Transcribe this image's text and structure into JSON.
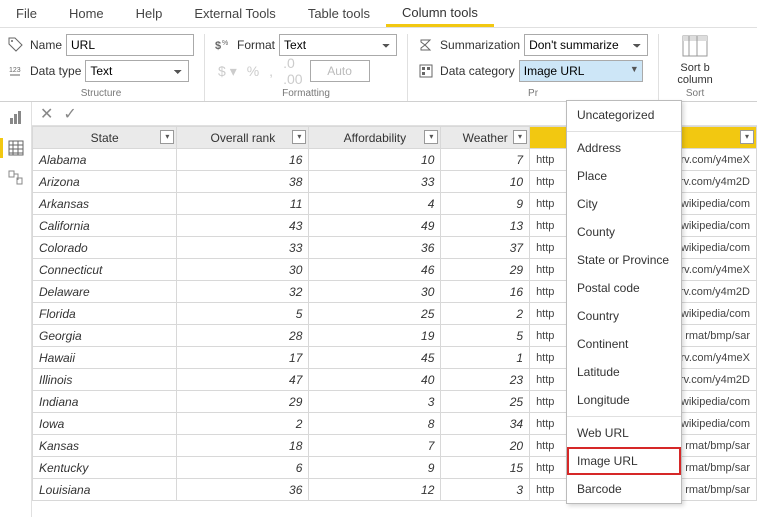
{
  "menu": {
    "items": [
      "File",
      "Home",
      "Help",
      "External Tools",
      "Table tools",
      "Column tools"
    ],
    "active": 5
  },
  "ribbon": {
    "name_label": "Name",
    "name_value": "URL",
    "datatype_label": "Data type",
    "datatype_value": "Text",
    "format_label": "Format",
    "format_value": "Text",
    "auto_label": "Auto",
    "summ_label": "Summarization",
    "summ_value": "Don't summarize",
    "datacat_label": "Data category",
    "datacat_value": "Image URL",
    "group_structure": "Structure",
    "group_formatting": "Formatting",
    "group_properties": "Pr",
    "group_sort": "Sort",
    "sort_label": "Sort b",
    "sort_label2": "column"
  },
  "columns": [
    {
      "name": "State",
      "active": false
    },
    {
      "name": "Overall rank",
      "active": false
    },
    {
      "name": "Affordability",
      "active": false
    },
    {
      "name": "Weather",
      "active": false
    },
    {
      "name": "",
      "active": true
    }
  ],
  "rows": [
    {
      "state": "Alabama",
      "rank": 16,
      "aff": 10,
      "weather": 7,
      "url": "http"
    },
    {
      "state": "Arizona",
      "rank": 38,
      "aff": 33,
      "weather": 10,
      "url": "http"
    },
    {
      "state": "Arkansas",
      "rank": 11,
      "aff": 4,
      "weather": 9,
      "url": "http"
    },
    {
      "state": "California",
      "rank": 43,
      "aff": 49,
      "weather": 13,
      "url": "http"
    },
    {
      "state": "Colorado",
      "rank": 33,
      "aff": 36,
      "weather": 37,
      "url": "http"
    },
    {
      "state": "Connecticut",
      "rank": 30,
      "aff": 46,
      "weather": 29,
      "url": "http"
    },
    {
      "state": "Delaware",
      "rank": 32,
      "aff": 30,
      "weather": 16,
      "url": "http"
    },
    {
      "state": "Florida",
      "rank": 5,
      "aff": 25,
      "weather": 2,
      "url": "http"
    },
    {
      "state": "Georgia",
      "rank": 28,
      "aff": 19,
      "weather": 5,
      "url": "http"
    },
    {
      "state": "Hawaii",
      "rank": 17,
      "aff": 45,
      "weather": 1,
      "url": "http"
    },
    {
      "state": "Illinois",
      "rank": 47,
      "aff": 40,
      "weather": 23,
      "url": "http"
    },
    {
      "state": "Indiana",
      "rank": 29,
      "aff": 3,
      "weather": 25,
      "url": "http"
    },
    {
      "state": "Iowa",
      "rank": 2,
      "aff": 8,
      "weather": 34,
      "url": "http"
    },
    {
      "state": "Kansas",
      "rank": 18,
      "aff": 7,
      "weather": 20,
      "url": "http"
    },
    {
      "state": "Kentucky",
      "rank": 6,
      "aff": 9,
      "weather": 15,
      "url": "http"
    },
    {
      "state": "Louisiana",
      "rank": 36,
      "aff": 12,
      "weather": 3,
      "url": "http"
    }
  ],
  "row_tails": [
    "rv.com/y4meX",
    "rv.com/y4m2D",
    "wikipedia/com",
    "wikipedia/com",
    "wikipedia/com",
    "rv.com/y4meX",
    "rv.com/y4m2D",
    "wikipedia/com",
    "rmat/bmp/sar",
    "rv.com/y4meX",
    "rv.com/y4m2D",
    "wikipedia/com",
    "wikipedia/com",
    "rmat/bmp/sar",
    "rmat/bmp/sar",
    "rmat/bmp/sar"
  ],
  "dropdown": {
    "groups": [
      [
        "Uncategorized"
      ],
      [
        "Address",
        "Place",
        "City",
        "County",
        "State or Province",
        "Postal code",
        "Country",
        "Continent",
        "Latitude",
        "Longitude"
      ],
      [
        "Web URL",
        "Image URL",
        "Barcode"
      ]
    ],
    "highlight": "Image URL"
  }
}
